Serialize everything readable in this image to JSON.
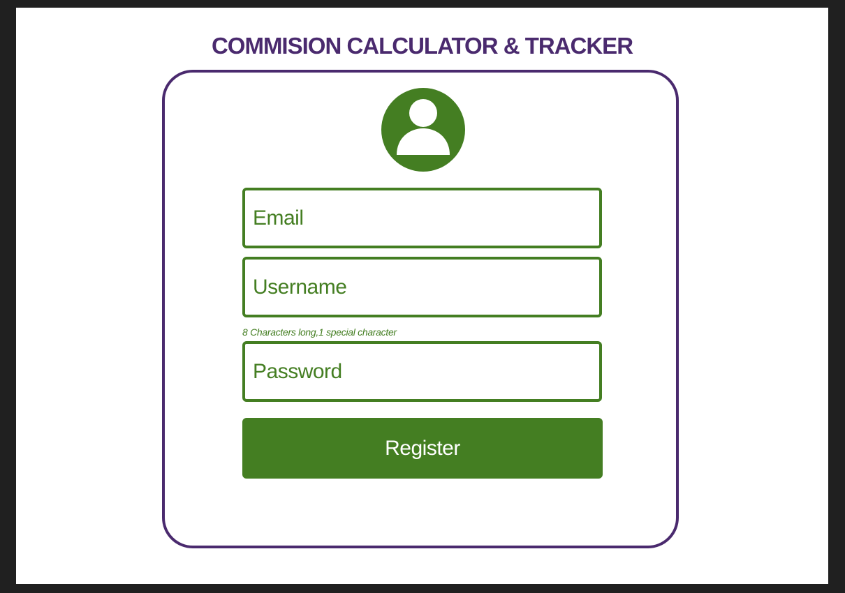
{
  "header": {
    "title": "COMMISION CALCULATOR & TRACKER"
  },
  "form": {
    "avatar_icon": "user-avatar-icon",
    "email_placeholder": "Email",
    "username_placeholder": "Username",
    "password_hint": "8 Characters long,1 special character",
    "password_placeholder": "Password",
    "register_label": "Register"
  },
  "colors": {
    "accent_purple": "#4a2a6e",
    "accent_green": "#447e22",
    "background_dark": "#202020",
    "page_background": "#ffffff"
  }
}
